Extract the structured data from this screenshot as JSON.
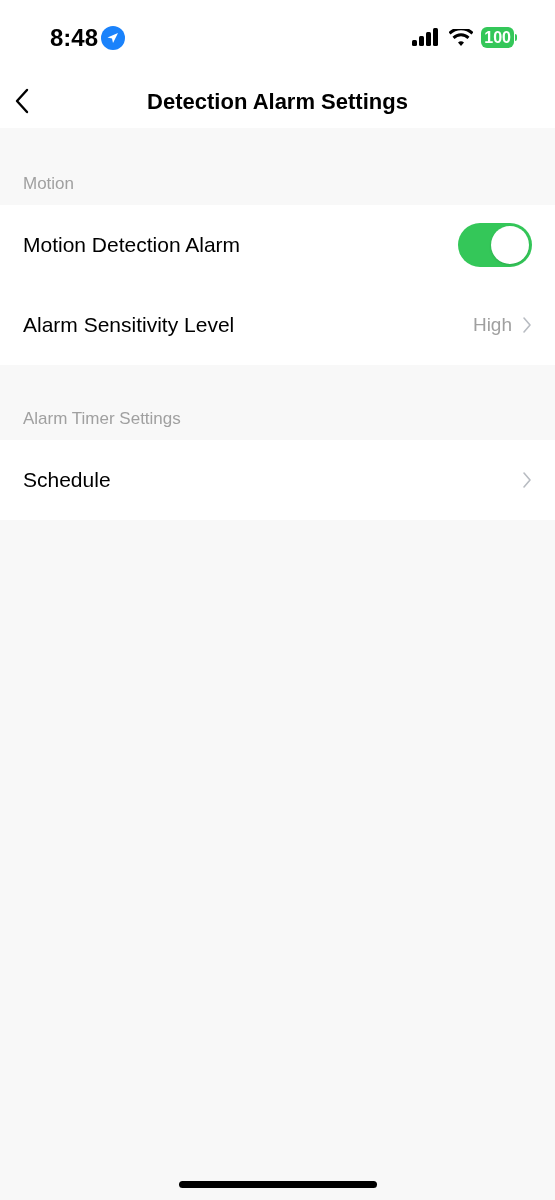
{
  "status_bar": {
    "time": "8:48",
    "battery": "100"
  },
  "nav": {
    "title": "Detection Alarm Settings"
  },
  "sections": [
    {
      "header": "Motion",
      "rows": [
        {
          "kind": "toggle",
          "label": "Motion Detection Alarm",
          "on": true
        },
        {
          "kind": "link",
          "label": "Alarm Sensitivity Level",
          "value": "High"
        }
      ]
    },
    {
      "header": "Alarm Timer Settings",
      "rows": [
        {
          "kind": "link",
          "label": "Schedule"
        }
      ]
    }
  ]
}
